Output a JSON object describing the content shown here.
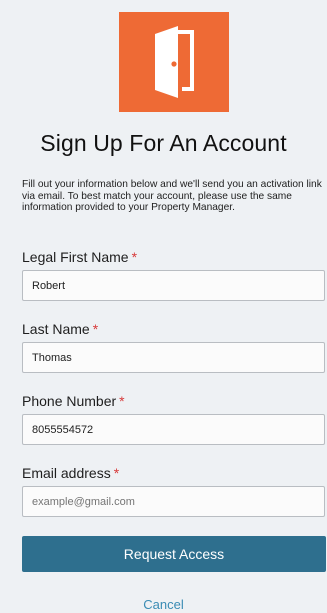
{
  "brand": {
    "logo_icon": "door-icon",
    "logo_color": "#ee6a35"
  },
  "page": {
    "title": "Sign Up For An Account",
    "intro": "Fill out your information below and we'll send you an activation link via email. To best match your account, please use the same information provided to your Property Manager."
  },
  "form": {
    "required_marker": "*",
    "first_name": {
      "label": "Legal First Name",
      "value": "Robert"
    },
    "last_name": {
      "label": "Last Name",
      "value": "Thomas"
    },
    "phone": {
      "label": "Phone Number",
      "value": "8055554572"
    },
    "email": {
      "label": "Email address",
      "value": "",
      "placeholder": "example@gmail.com"
    }
  },
  "actions": {
    "submit_label": "Request Access",
    "cancel_label": "Cancel"
  },
  "colors": {
    "primary": "#2e6f8e",
    "link": "#3a8cb4",
    "required": "#d73a3a",
    "background": "#eef1f4"
  }
}
